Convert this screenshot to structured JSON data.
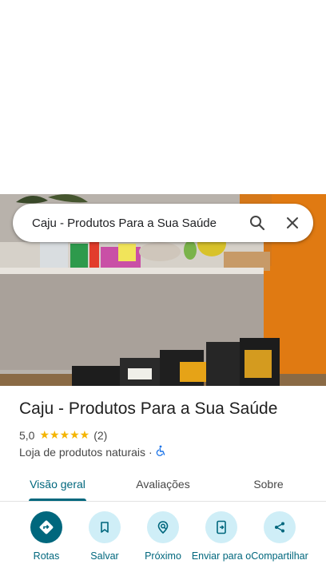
{
  "search": {
    "query": "Caju - Produtos Para a Sua Saúde"
  },
  "place": {
    "name": "Caju - Produtos Para a Sua Saúde",
    "rating": "5,0",
    "stars": "★★★★★",
    "review_count": "(2)",
    "category": "Loja de produtos naturais",
    "separator": "·",
    "accessibility_icon": "wheelchair-icon"
  },
  "tabs": [
    {
      "label": "Visão geral",
      "active": true
    },
    {
      "label": "Avaliações",
      "active": false
    },
    {
      "label": "Sobre",
      "active": false
    }
  ],
  "actions": [
    {
      "label": "Rotas",
      "icon": "directions-icon"
    },
    {
      "label": "Salvar",
      "icon": "bookmark-icon"
    },
    {
      "label": "Próximo",
      "icon": "nearby-icon"
    },
    {
      "label": "Enviar para o",
      "icon": "send-to-phone-icon"
    },
    {
      "label": "Compartilhar",
      "icon": "share-icon"
    }
  ],
  "colors": {
    "accent": "#00677d",
    "action_bg": "#cfeef7",
    "star": "#f4b400",
    "wall_orange": "#e07a12"
  }
}
